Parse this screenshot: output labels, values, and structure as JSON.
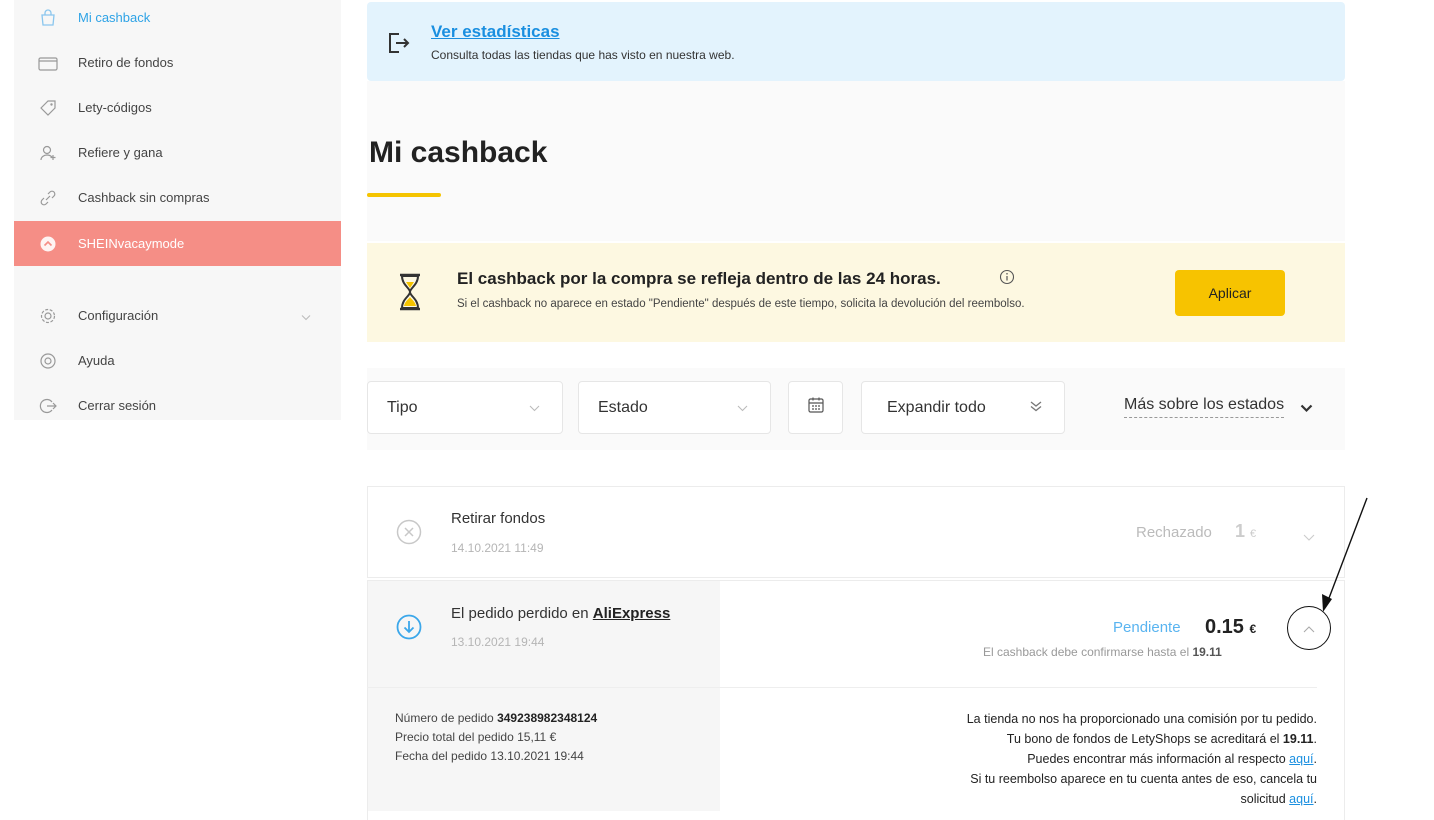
{
  "sidebar": {
    "items": [
      {
        "label": "Mi cashback",
        "icon": "bag-icon"
      },
      {
        "label": "Retiro de fondos",
        "icon": "wallet-icon"
      },
      {
        "label": "Lety-códigos",
        "icon": "tag-icon"
      },
      {
        "label": "Refiere y gana",
        "icon": "user-add-icon"
      },
      {
        "label": "Cashback sin compras",
        "icon": "link-icon"
      },
      {
        "label": "SHEINvacaymode",
        "icon": "promo-icon"
      },
      {
        "label": "Configuración",
        "icon": "gear-icon"
      },
      {
        "label": "Ayuda",
        "icon": "help-icon"
      },
      {
        "label": "Cerrar sesión",
        "icon": "logout-icon"
      }
    ]
  },
  "stats_banner": {
    "link": "Ver estadísticas",
    "subtitle": "Consulta todas las tiendas que has visto en nuestra web."
  },
  "page": {
    "title": "Mi cashback",
    "accent": "#f5c400"
  },
  "notice": {
    "title": "El cashback por la compra se refleja dentro de las 24 horas.",
    "subtitle": "Si el cashback no aparece en estado \"Pendiente\" después de este tiempo, solicita la devolución del reembolso.",
    "button": "Aplicar"
  },
  "filters": {
    "type": "Tipo",
    "status": "Estado",
    "expand": "Expandir todo",
    "more_states": "Más sobre los estados"
  },
  "transactions": [
    {
      "title": "Retirar fondos",
      "date": "14.10.2021 11:49",
      "status": "Rechazado",
      "amount": "1",
      "currency": "€"
    },
    {
      "title_prefix": "El pedido perdido en",
      "store": "AliExpress",
      "date": "13.10.2021 19:44",
      "status": "Pendiente",
      "amount": "0.15",
      "currency": "€",
      "confirm_prefix": "El cashback debe confirmarse hasta el",
      "confirm_date": "19.11",
      "details": {
        "order_label": "Número de pedido",
        "order_number": "349238982348124",
        "total_label": "Precio total del pedido",
        "total_value": "15,11 €",
        "date_label": "Fecha del pedido",
        "date_value": "13.10.2021 19:44"
      },
      "message": {
        "line1": "La tienda no nos ha proporcionado una comisión por tu pedido.",
        "line2_prefix": "Tu bono de fondos de LetyShops se acreditará el",
        "line2_date": "19.11",
        "line2_suffix": ".",
        "line3_prefix": "Puedes encontrar más información al respecto",
        "line3_link": "aquí",
        "line3_suffix": ".",
        "line4": "Si tu reembolso aparece en tu cuenta antes de eso, cancela tu",
        "line5_prefix": "solicitud",
        "line5_link": "aquí",
        "line5_suffix": "."
      }
    }
  ],
  "colors": {
    "link": "#1a8fe0",
    "pending": "#59b4f0",
    "promo": "#f58e86",
    "button": "#f7c300"
  }
}
